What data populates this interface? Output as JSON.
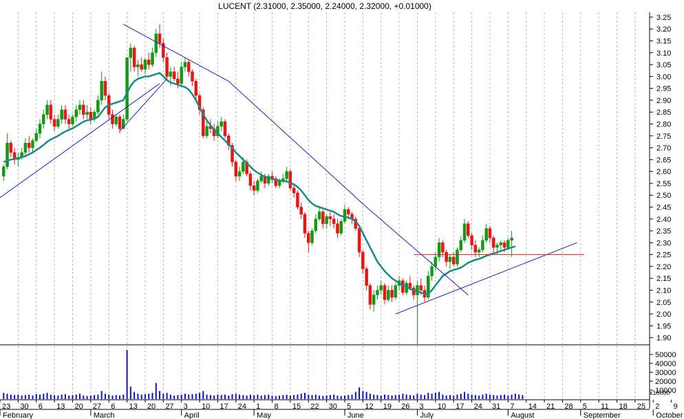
{
  "chart_data": {
    "type": "candlestick",
    "title": "LUCENT (2.31000, 2.35000, 2.24000, 2.32000, +0.01000)",
    "price_axis": {
      "ylim": [
        1.87,
        3.27
      ],
      "ticks": [
        "3.25",
        "3.20",
        "3.15",
        "3.10",
        "3.05",
        "3.00",
        "2.95",
        "2.90",
        "2.85",
        "2.80",
        "2.75",
        "2.70",
        "2.65",
        "2.60",
        "2.55",
        "2.50",
        "2.45",
        "2.40",
        "2.35",
        "2.30",
        "2.25",
        "2.20",
        "2.15",
        "2.10",
        "2.05",
        "2.00",
        "1.95",
        "1.90"
      ]
    },
    "volume_axis": {
      "ylim": [
        0,
        60000
      ],
      "ticks": [
        "50000",
        "40000",
        "30000",
        "20000",
        "10000"
      ],
      "scale_note": "x10000"
    },
    "grid": "vertical-dotted",
    "day_labels": [
      "23",
      "30",
      "6",
      "13",
      "20",
      "27",
      "6",
      "13",
      "20",
      "27",
      "3",
      "10",
      "17",
      "24",
      "1",
      "8",
      "15",
      "22",
      "30",
      "5",
      "12",
      "19",
      "26",
      "3",
      "10",
      "17",
      "24",
      "31",
      "7",
      "14",
      "21",
      "28",
      "5",
      "11",
      "18",
      "25",
      "2",
      "9"
    ],
    "month_labels": [
      "February",
      "March",
      "April",
      "May",
      "June",
      "July",
      "August",
      "September",
      "October"
    ],
    "colors": {
      "up": "#129a12",
      "down": "#e81616",
      "moving_average": "#178a85",
      "trendline": "#2020c0",
      "support": "#d02020",
      "volume": "#1010c0",
      "grid": "#b8b8b8"
    },
    "x_range": [
      -1,
      178
    ],
    "candles": [
      [
        2.58,
        2.63,
        2.56,
        2.62
      ],
      [
        2.62,
        2.76,
        2.61,
        2.72
      ],
      [
        2.72,
        2.73,
        2.66,
        2.68
      ],
      [
        2.68,
        2.7,
        2.63,
        2.65
      ],
      [
        2.65,
        2.68,
        2.62,
        2.66
      ],
      [
        2.66,
        2.7,
        2.65,
        2.68
      ],
      [
        2.68,
        2.74,
        2.66,
        2.72
      ],
      [
        2.72,
        2.75,
        2.68,
        2.7
      ],
      [
        2.7,
        2.74,
        2.68,
        2.73
      ],
      [
        2.73,
        2.78,
        2.72,
        2.76
      ],
      [
        2.76,
        2.82,
        2.74,
        2.8
      ],
      [
        2.8,
        2.86,
        2.78,
        2.84
      ],
      [
        2.84,
        2.9,
        2.82,
        2.88
      ],
      [
        2.88,
        2.9,
        2.8,
        2.82
      ],
      [
        2.82,
        2.84,
        2.77,
        2.79
      ],
      [
        2.79,
        2.84,
        2.78,
        2.82
      ],
      [
        2.82,
        2.88,
        2.8,
        2.86
      ],
      [
        2.86,
        2.88,
        2.8,
        2.82
      ],
      [
        2.82,
        2.84,
        2.78,
        2.8
      ],
      [
        2.8,
        2.84,
        2.79,
        2.83
      ],
      [
        2.83,
        2.88,
        2.81,
        2.86
      ],
      [
        2.86,
        2.9,
        2.84,
        2.88
      ],
      [
        2.88,
        2.9,
        2.82,
        2.84
      ],
      [
        2.84,
        2.88,
        2.82,
        2.85
      ],
      [
        2.85,
        2.87,
        2.8,
        2.82
      ],
      [
        2.82,
        2.86,
        2.81,
        2.85
      ],
      [
        2.85,
        2.92,
        2.84,
        2.9
      ],
      [
        2.9,
        3.02,
        2.88,
        2.98
      ],
      [
        2.98,
        3.0,
        2.9,
        2.92
      ],
      [
        2.92,
        2.93,
        2.82,
        2.84
      ],
      [
        2.84,
        2.86,
        2.78,
        2.8
      ],
      [
        2.8,
        2.84,
        2.79,
        2.83
      ],
      [
        2.83,
        2.84,
        2.76,
        2.78
      ],
      [
        2.78,
        2.84,
        2.78,
        2.82
      ],
      [
        2.82,
        3.05,
        2.81,
        3.08
      ],
      [
        3.08,
        3.14,
        3.02,
        3.12
      ],
      [
        3.12,
        3.13,
        3.02,
        3.04
      ],
      [
        3.04,
        3.07,
        3.0,
        3.05
      ],
      [
        3.05,
        3.08,
        3.02,
        3.03
      ],
      [
        3.03,
        3.08,
        3.01,
        3.07
      ],
      [
        3.07,
        3.1,
        3.03,
        3.05
      ],
      [
        3.05,
        3.12,
        3.04,
        3.1
      ],
      [
        3.1,
        3.2,
        3.08,
        3.18
      ],
      [
        3.18,
        3.22,
        3.12,
        3.14
      ],
      [
        3.14,
        3.16,
        3.06,
        3.08
      ],
      [
        3.08,
        3.1,
        2.98,
        3.0
      ],
      [
        3.0,
        3.04,
        2.96,
        3.02
      ],
      [
        3.02,
        3.04,
        2.98,
        2.99
      ],
      [
        2.99,
        3.02,
        2.95,
        2.97
      ],
      [
        2.97,
        3.06,
        2.96,
        3.04
      ],
      [
        3.04,
        3.08,
        3.02,
        3.06
      ],
      [
        3.06,
        3.07,
        3.0,
        3.02
      ],
      [
        3.02,
        3.03,
        2.96,
        2.98
      ],
      [
        2.98,
        2.99,
        2.9,
        2.92
      ],
      [
        2.92,
        2.93,
        2.84,
        2.86
      ],
      [
        2.86,
        2.87,
        2.74,
        2.75
      ],
      [
        2.75,
        2.82,
        2.74,
        2.79
      ],
      [
        2.79,
        2.82,
        2.76,
        2.78
      ],
      [
        2.78,
        2.8,
        2.73,
        2.75
      ],
      [
        2.75,
        2.81,
        2.74,
        2.79
      ],
      [
        2.79,
        2.83,
        2.77,
        2.81
      ],
      [
        2.81,
        2.82,
        2.74,
        2.75
      ],
      [
        2.75,
        2.76,
        2.69,
        2.71
      ],
      [
        2.71,
        2.72,
        2.62,
        2.64
      ],
      [
        2.64,
        2.65,
        2.56,
        2.58
      ],
      [
        2.58,
        2.62,
        2.56,
        2.6
      ],
      [
        2.6,
        2.66,
        2.59,
        2.64
      ],
      [
        2.64,
        2.65,
        2.58,
        2.59
      ],
      [
        2.59,
        2.6,
        2.52,
        2.54
      ],
      [
        2.54,
        2.56,
        2.5,
        2.52
      ],
      [
        2.52,
        2.57,
        2.51,
        2.56
      ],
      [
        2.56,
        2.6,
        2.55,
        2.58
      ],
      [
        2.58,
        2.59,
        2.53,
        2.55
      ],
      [
        2.55,
        2.59,
        2.54,
        2.58
      ],
      [
        2.58,
        2.6,
        2.55,
        2.57
      ],
      [
        2.57,
        2.58,
        2.53,
        2.54
      ],
      [
        2.54,
        2.57,
        2.53,
        2.56
      ],
      [
        2.56,
        2.59,
        2.55,
        2.57
      ],
      [
        2.57,
        2.62,
        2.56,
        2.6
      ],
      [
        2.6,
        2.61,
        2.52,
        2.53
      ],
      [
        2.53,
        2.55,
        2.49,
        2.51
      ],
      [
        2.51,
        2.52,
        2.44,
        2.45
      ],
      [
        2.45,
        2.47,
        2.4,
        2.42
      ],
      [
        2.42,
        2.43,
        2.32,
        2.34
      ],
      [
        2.34,
        2.35,
        2.26,
        2.3
      ],
      [
        2.3,
        2.36,
        2.29,
        2.35
      ],
      [
        2.35,
        2.42,
        2.34,
        2.4
      ],
      [
        2.4,
        2.45,
        2.39,
        2.43
      ],
      [
        2.43,
        2.44,
        2.36,
        2.38
      ],
      [
        2.38,
        2.42,
        2.36,
        2.41
      ],
      [
        2.41,
        2.43,
        2.37,
        2.4
      ],
      [
        2.4,
        2.42,
        2.36,
        2.38
      ],
      [
        2.38,
        2.4,
        2.32,
        2.34
      ],
      [
        2.34,
        2.4,
        2.33,
        2.39
      ],
      [
        2.39,
        2.46,
        2.38,
        2.44
      ],
      [
        2.44,
        2.45,
        2.4,
        2.42
      ],
      [
        2.42,
        2.43,
        2.38,
        2.4
      ],
      [
        2.4,
        2.41,
        2.35,
        2.36
      ],
      [
        2.36,
        2.37,
        2.24,
        2.26
      ],
      [
        2.26,
        2.27,
        2.17,
        2.19
      ],
      [
        2.19,
        2.2,
        2.1,
        2.12
      ],
      [
        2.12,
        2.13,
        2.02,
        2.04
      ],
      [
        2.04,
        2.1,
        2.01,
        2.08
      ],
      [
        2.08,
        2.12,
        2.06,
        2.1
      ],
      [
        2.1,
        2.14,
        2.08,
        2.12
      ],
      [
        2.12,
        2.13,
        2.04,
        2.06
      ],
      [
        2.06,
        2.12,
        2.05,
        2.1
      ],
      [
        2.1,
        2.12,
        2.05,
        2.07
      ],
      [
        2.07,
        2.13,
        2.06,
        2.12
      ],
      [
        2.12,
        2.16,
        2.1,
        2.14
      ],
      [
        2.14,
        2.15,
        2.08,
        2.09
      ],
      [
        2.09,
        2.14,
        2.08,
        2.13
      ],
      [
        2.13,
        2.16,
        2.1,
        2.11
      ],
      [
        2.11,
        2.12,
        2.06,
        2.08
      ],
      [
        2.08,
        2.14,
        1.87,
        2.12
      ],
      [
        2.12,
        2.15,
        2.08,
        2.1
      ],
      [
        2.1,
        2.12,
        2.05,
        2.07
      ],
      [
        2.07,
        2.18,
        2.06,
        2.16
      ],
      [
        2.16,
        2.22,
        2.14,
        2.2
      ],
      [
        2.2,
        2.26,
        2.18,
        2.24
      ],
      [
        2.24,
        2.32,
        2.22,
        2.3
      ],
      [
        2.3,
        2.31,
        2.24,
        2.26
      ],
      [
        2.26,
        2.27,
        2.2,
        2.22
      ],
      [
        2.22,
        2.25,
        2.19,
        2.24
      ],
      [
        2.24,
        2.26,
        2.2,
        2.21
      ],
      [
        2.21,
        2.28,
        2.2,
        2.27
      ],
      [
        2.27,
        2.33,
        2.26,
        2.31
      ],
      [
        2.31,
        2.4,
        2.3,
        2.38
      ],
      [
        2.38,
        2.39,
        2.32,
        2.33
      ],
      [
        2.33,
        2.34,
        2.27,
        2.29
      ],
      [
        2.29,
        2.31,
        2.24,
        2.26
      ],
      [
        2.26,
        2.28,
        2.24,
        2.27
      ],
      [
        2.27,
        2.33,
        2.26,
        2.31
      ],
      [
        2.31,
        2.38,
        2.3,
        2.36
      ],
      [
        2.36,
        2.37,
        2.3,
        2.32
      ],
      [
        2.32,
        2.33,
        2.26,
        2.28
      ],
      [
        2.28,
        2.3,
        2.25,
        2.29
      ],
      [
        2.29,
        2.31,
        2.27,
        2.3
      ],
      [
        2.3,
        2.31,
        2.26,
        2.28
      ],
      [
        2.28,
        2.32,
        2.27,
        2.31
      ],
      [
        2.31,
        2.35,
        2.24,
        2.32
      ]
    ],
    "moving_average": [
      2.64,
      2.645,
      2.65,
      2.652,
      2.655,
      2.66,
      2.665,
      2.672,
      2.68,
      2.69,
      2.7,
      2.712,
      2.725,
      2.735,
      2.742,
      2.75,
      2.76,
      2.768,
      2.775,
      2.782,
      2.79,
      2.8,
      2.81,
      2.815,
      2.818,
      2.822,
      2.83,
      2.85,
      2.87,
      2.88,
      2.885,
      2.89,
      2.895,
      2.9,
      2.93,
      2.96,
      2.98,
      2.99,
      2.995,
      3.0,
      3.0,
      3.005,
      3.01,
      3.015,
      3.0,
      2.985,
      2.975,
      2.97,
      2.965,
      2.96,
      2.955,
      2.945,
      2.925,
      2.9,
      2.87,
      2.84,
      2.815,
      2.795,
      2.775,
      2.76,
      2.745,
      2.73,
      2.715,
      2.7,
      2.68,
      2.665,
      2.65,
      2.635,
      2.62,
      2.605,
      2.595,
      2.585,
      2.578,
      2.572,
      2.568,
      2.565,
      2.562,
      2.56,
      2.558,
      2.552,
      2.545,
      2.535,
      2.52,
      2.5,
      2.48,
      2.465,
      2.455,
      2.45,
      2.445,
      2.44,
      2.435,
      2.43,
      2.42,
      2.412,
      2.41,
      2.405,
      2.4,
      2.39,
      2.37,
      2.34,
      2.31,
      2.28,
      2.25,
      2.22,
      2.2,
      2.18,
      2.165,
      2.15,
      2.14,
      2.13,
      2.12,
      2.115,
      2.105,
      2.1,
      2.095,
      2.09,
      2.085,
      2.085,
      2.1,
      2.12,
      2.14,
      2.16,
      2.17,
      2.18,
      2.185,
      2.19,
      2.195,
      2.205,
      2.215,
      2.222,
      2.228,
      2.232,
      2.238,
      2.245,
      2.25,
      2.255,
      2.26,
      2.265,
      2.27,
      2.275,
      2.28,
      2.285
    ],
    "trendlines": [
      {
        "kind": "trendline",
        "points": [
          [
            -1,
            2.49
          ],
          [
            43,
            2.97
          ]
        ]
      },
      {
        "kind": "trendline",
        "points": [
          [
            32,
            2.77
          ],
          [
            45,
            2.99
          ]
        ]
      },
      {
        "kind": "trendline",
        "points": [
          [
            33,
            3.22
          ],
          [
            62,
            2.98
          ],
          [
            100,
            2.45
          ],
          [
            128,
            2.08
          ]
        ]
      },
      {
        "kind": "trendline",
        "points": [
          [
            108,
            2.0
          ],
          [
            158,
            2.3
          ]
        ]
      },
      {
        "kind": "support",
        "points": [
          [
            113,
            2.25
          ],
          [
            160,
            2.25
          ]
        ]
      }
    ],
    "volume": [
      7000,
      6000,
      5000,
      4500,
      5000,
      4000,
      4500,
      5000,
      4000,
      5500,
      5000,
      6000,
      7000,
      5000,
      4500,
      4000,
      5000,
      5500,
      4000,
      4500,
      5000,
      6000,
      4000,
      3500,
      4000,
      4500,
      5000,
      9000,
      6000,
      5000,
      4000,
      4500,
      4000,
      5000,
      55000,
      14000,
      8000,
      6000,
      5000,
      5500,
      6000,
      7000,
      18000,
      9000,
      6000,
      7000,
      5000,
      4000,
      4500,
      5000,
      6000,
      5000,
      5500,
      6000,
      7000,
      9000,
      5000,
      4500,
      4000,
      5000,
      4500,
      5000,
      4000,
      5500,
      6000,
      5000,
      4500,
      4000,
      5000,
      4500,
      5000,
      4000,
      4500,
      5000,
      4000,
      3500,
      4000,
      4500,
      5000,
      4000,
      4500,
      5000,
      6000,
      7000,
      5000,
      4500,
      5000,
      4000,
      3500,
      4000,
      4500,
      5000,
      4000,
      3500,
      4000,
      4500,
      5000,
      8000,
      13000,
      9000,
      8000,
      6000,
      5000,
      4500,
      4000,
      5000,
      4500,
      4000,
      4500,
      5000,
      6000,
      5000,
      4500,
      4000,
      6000,
      5000,
      4500,
      7000,
      6000,
      7000,
      8000,
      5000,
      4000,
      4500,
      4000,
      5000,
      6000,
      8000,
      6000,
      5000,
      4500,
      4000,
      5000,
      6000,
      5000,
      4500,
      4000,
      4500,
      5000,
      4000,
      5000,
      6000,
      5000,
      4500
    ]
  }
}
